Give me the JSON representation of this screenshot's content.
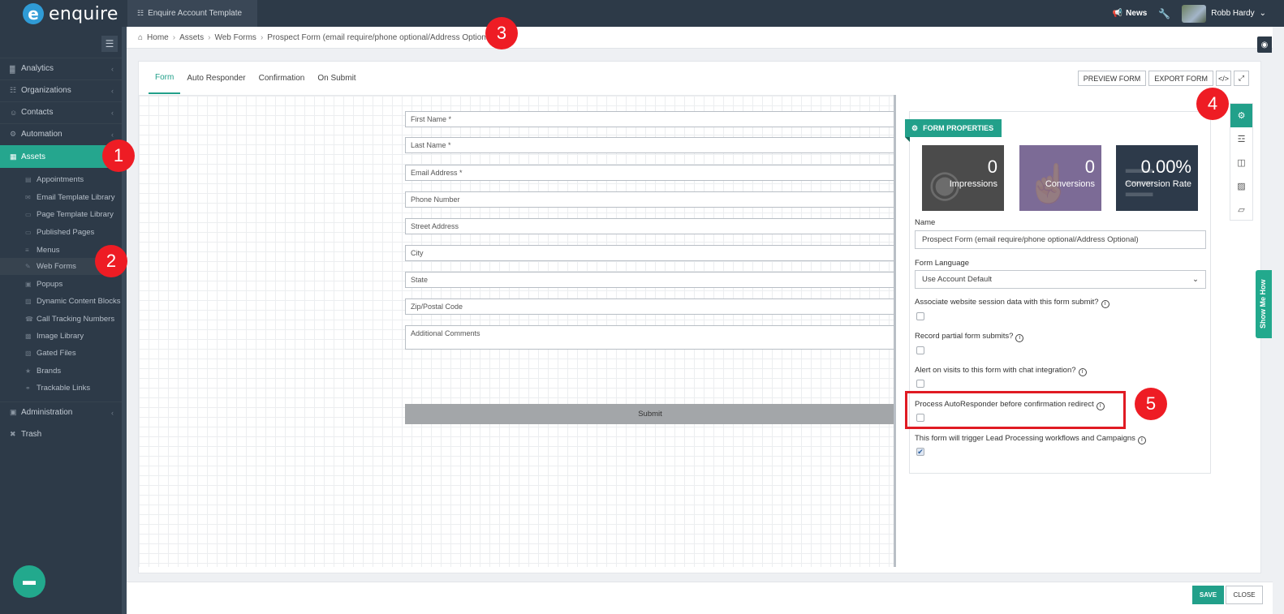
{
  "brand": {
    "name": "enquire",
    "mark": "e"
  },
  "account_tab": "Enquire Account Template",
  "topbar": {
    "news": "News",
    "user_name": "Robb Hardy"
  },
  "sidebar": {
    "items": [
      {
        "label": "Analytics",
        "icon": "bar-chart-icon"
      },
      {
        "label": "Organizations",
        "icon": "sitemap-icon"
      },
      {
        "label": "Contacts",
        "icon": "users-icon"
      },
      {
        "label": "Automation",
        "icon": "cogs-icon"
      },
      {
        "label": "Assets",
        "icon": "grid-icon",
        "active": true
      }
    ],
    "sub_items": [
      "Appointments",
      "Email Template Library",
      "Page Template Library",
      "Published Pages",
      "Menus",
      "Web Forms",
      "Popups",
      "Dynamic Content Blocks",
      "Call Tracking Numbers",
      "Image Library",
      "Gated Files",
      "Brands",
      "Trackable Links"
    ],
    "current_sub": "Web Forms",
    "bottom_items": [
      {
        "label": "Administration",
        "icon": "lock-icon"
      },
      {
        "label": "Trash",
        "icon": "trash-icon"
      }
    ]
  },
  "breadcrumb": [
    "Home",
    "Assets",
    "Web Forms",
    "Prospect Form (email require/phone optional/Address Optional)"
  ],
  "tabs": [
    "Form",
    "Auto Responder",
    "Confirmation",
    "On Submit"
  ],
  "active_tab": "Form",
  "toolbar": {
    "preview": "PREVIEW FORM",
    "export": "EXPORT FORM",
    "code": "</>",
    "expand": "⤢"
  },
  "form_fields": [
    "First Name *",
    "Last Name *",
    "Email Address *",
    "Phone Number",
    "Street Address",
    "City",
    "State",
    "Zip/Postal Code",
    "Additional Comments"
  ],
  "submit_label": "Submit",
  "properties": {
    "badge": "FORM PROPERTIES",
    "stats": [
      {
        "value": "0",
        "label": "Impressions",
        "color": "#4b4b4b"
      },
      {
        "value": "0",
        "label": "Conversions",
        "color": "#7c6b96"
      },
      {
        "value": "0.00%",
        "label": "Conversion Rate",
        "color": "#2d3a4a"
      }
    ],
    "name_label": "Name",
    "name_value": "Prospect Form (email require/phone optional/Address Optional)",
    "language_label": "Form Language",
    "language_value": "Use Account Default",
    "checkboxes": [
      {
        "label": "Associate website session data with this form submit?",
        "checked": false
      },
      {
        "label": "Record partial form submits?",
        "checked": false
      },
      {
        "label": "Alert on visits to this form with chat integration?",
        "checked": false
      },
      {
        "label": "Process AutoResponder before confirmation redirect",
        "checked": false
      },
      {
        "label": "This form will trigger Lead Processing workflows and Campaigns",
        "checked": true
      }
    ]
  },
  "show_me_how": "Show Me How",
  "footer": {
    "save": "SAVE",
    "close": "CLOSE"
  },
  "markers": [
    "1",
    "2",
    "3",
    "4",
    "5"
  ],
  "colors": {
    "accent": "#22a08a",
    "sidebar": "#2d3a48",
    "marker": "#ee1c24"
  }
}
